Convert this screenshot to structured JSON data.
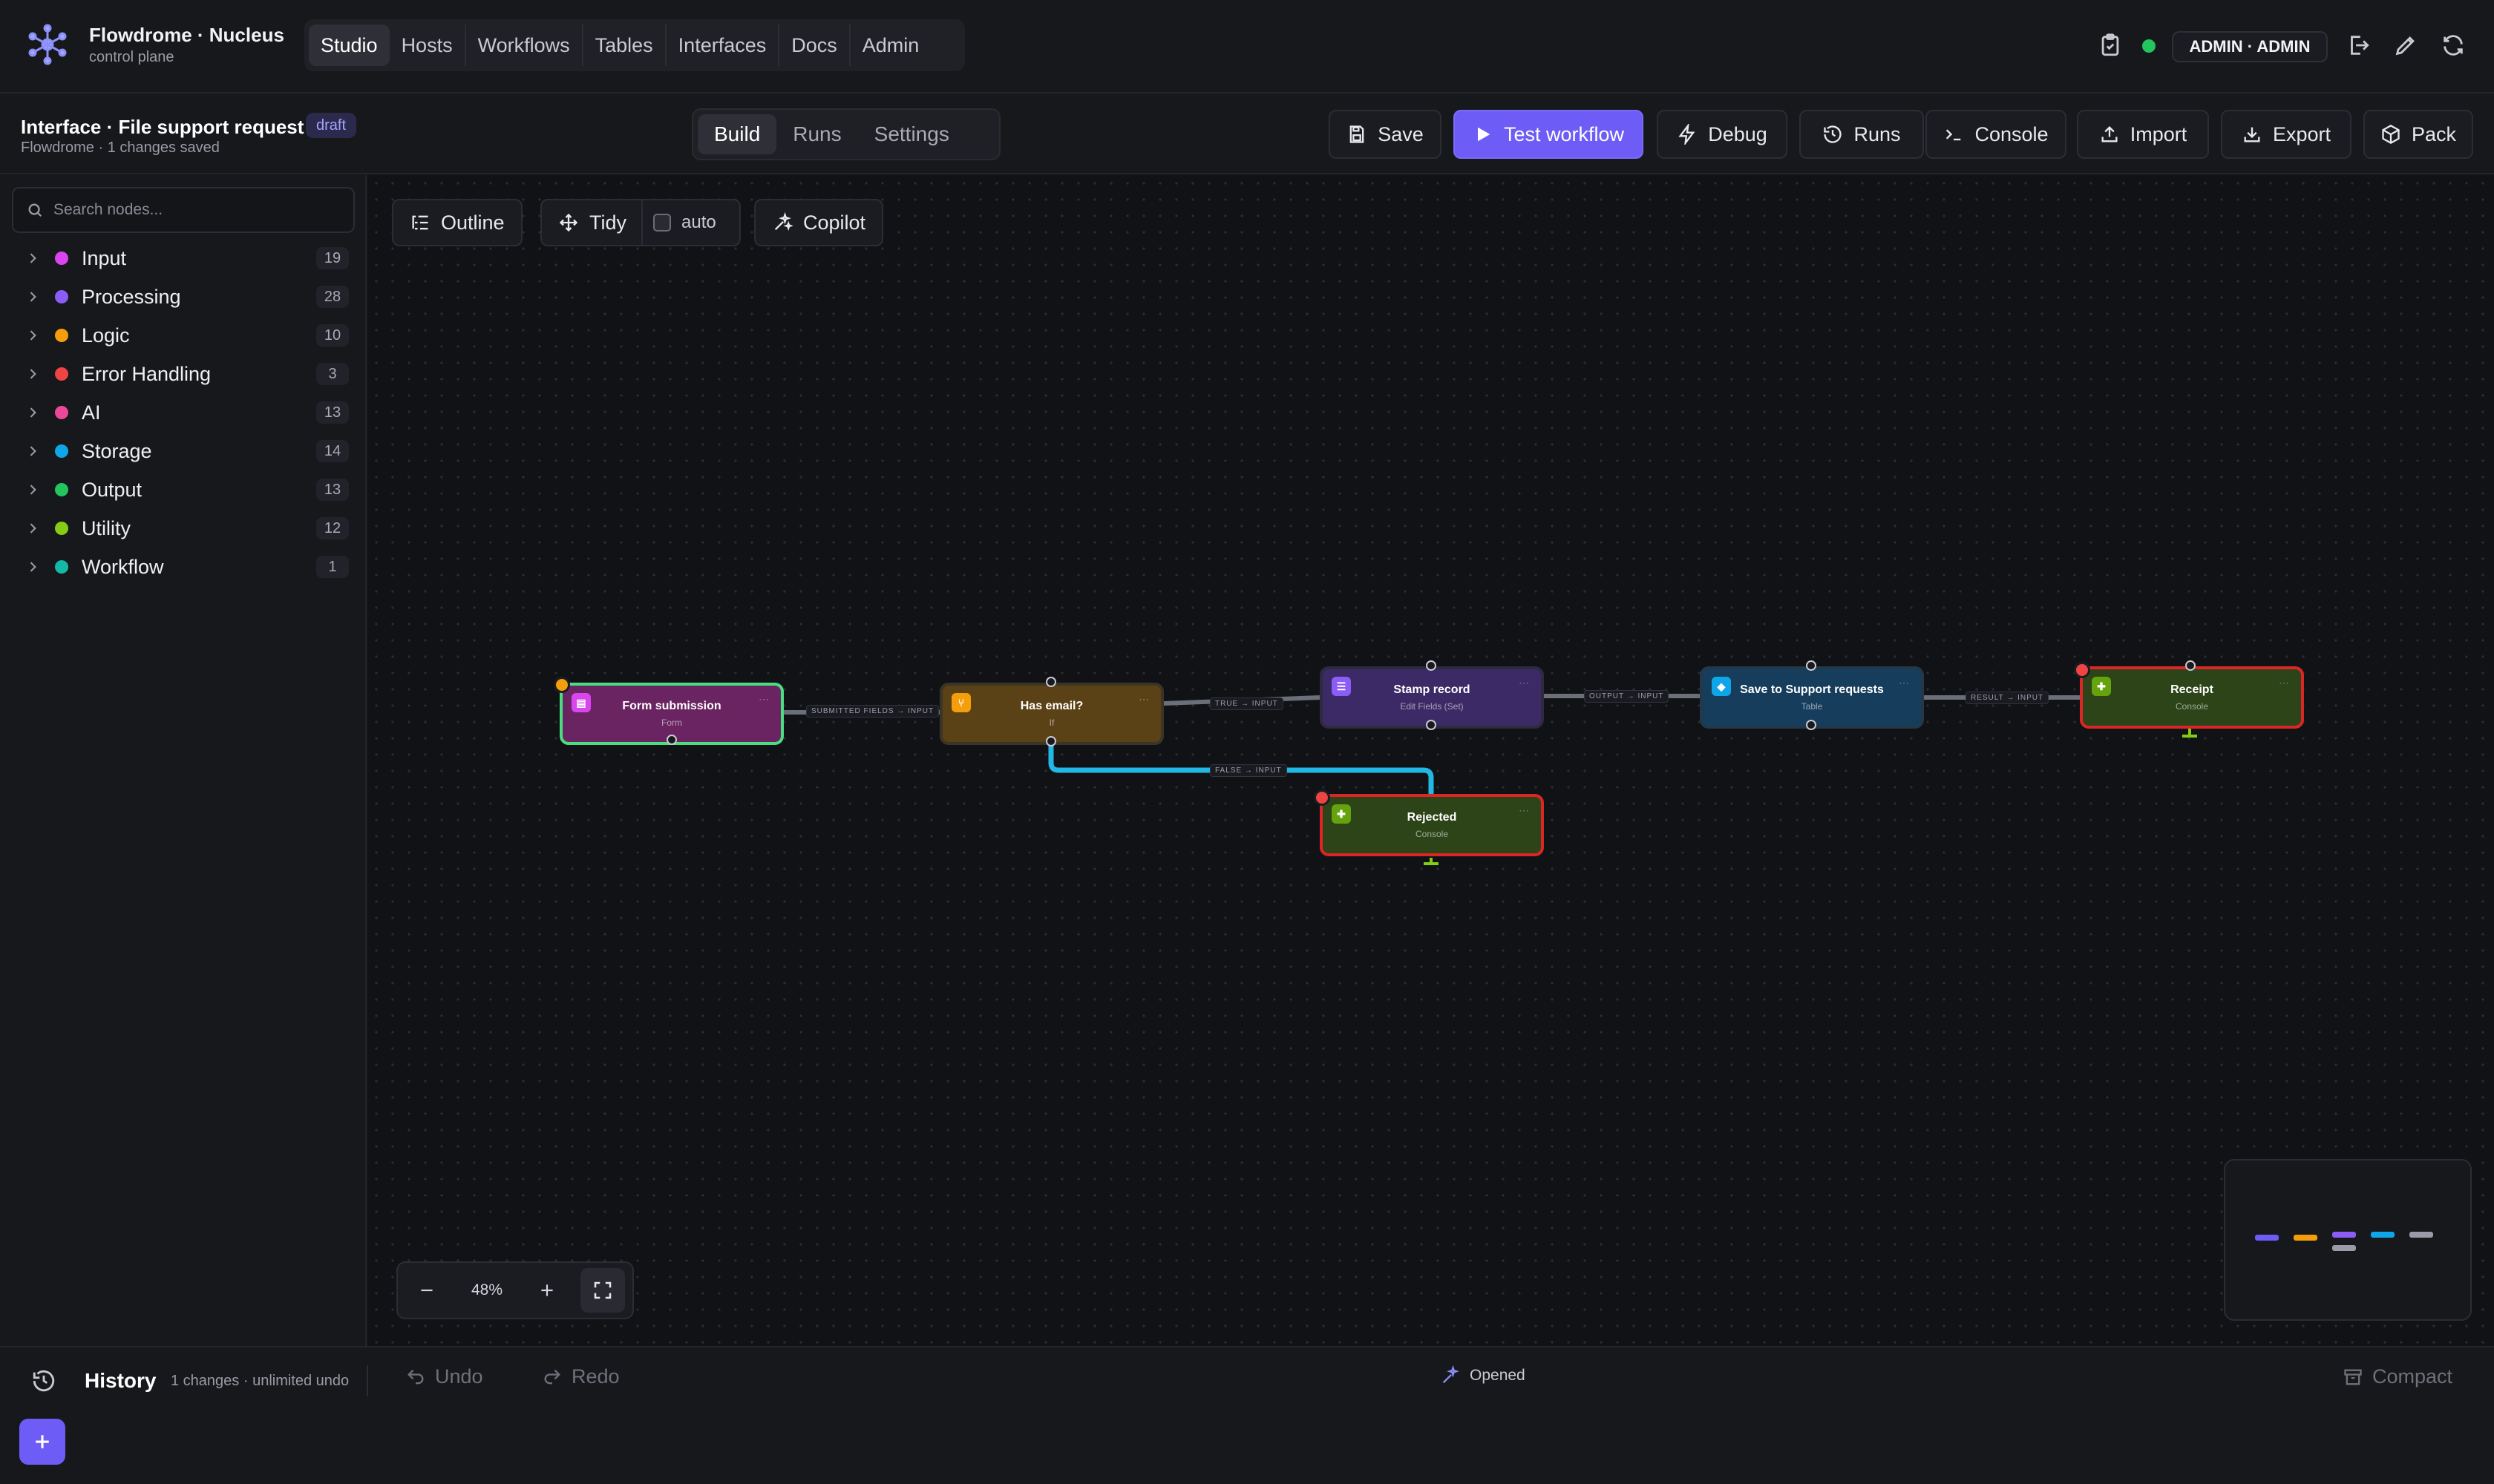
{
  "app": {
    "title": "Flowdrome · Nucleus",
    "subtitle": "control plane"
  },
  "nav": {
    "tabs": [
      "Studio",
      "Hosts",
      "Workflows",
      "Tables",
      "Interfaces",
      "Docs",
      "Admin"
    ],
    "active": "Studio"
  },
  "user": {
    "badge": "ADMIN · ADMIN",
    "status_color": "#22c55e"
  },
  "interface": {
    "title": "Interface · File support request",
    "status": "draft",
    "subtitle": "Flowdrome · 1 changes saved"
  },
  "mode_tabs": {
    "build": "Build",
    "runs": "Runs",
    "settings": "Settings",
    "active": "Build"
  },
  "toolbar": {
    "save": "Save",
    "test": "Test workflow",
    "debug": "Debug",
    "runs": "Runs",
    "console": "Console",
    "import": "Import",
    "export": "Export",
    "pack": "Pack"
  },
  "sidebar": {
    "search_placeholder": "Search nodes...",
    "categories": [
      {
        "label": "Input",
        "count": "19",
        "color": "#d946ef"
      },
      {
        "label": "Processing",
        "count": "28",
        "color": "#8b5cf6"
      },
      {
        "label": "Logic",
        "count": "10",
        "color": "#f59e0b"
      },
      {
        "label": "Error Handling",
        "count": "3",
        "color": "#ef4444"
      },
      {
        "label": "AI",
        "count": "13",
        "color": "#ec4899"
      },
      {
        "label": "Storage",
        "count": "14",
        "color": "#0ea5e9"
      },
      {
        "label": "Output",
        "count": "13",
        "color": "#22c55e"
      },
      {
        "label": "Utility",
        "count": "12",
        "color": "#84cc16"
      },
      {
        "label": "Workflow",
        "count": "1",
        "color": "#14b8a6"
      }
    ]
  },
  "canvas_toolbar": {
    "outline": "Outline",
    "tidy": "Tidy",
    "auto": "auto",
    "copilot": "Copilot"
  },
  "nodes": {
    "form": {
      "title": "Form submission",
      "type": "Form"
    },
    "has_email": {
      "title": "Has email?",
      "type": "If"
    },
    "stamp": {
      "title": "Stamp record",
      "type": "Edit Fields (Set)"
    },
    "save_support": {
      "title": "Save to Support requests",
      "type": "Table"
    },
    "receipt": {
      "title": "Receipt",
      "type": "Console"
    },
    "rejected": {
      "title": "Rejected",
      "type": "Console"
    }
  },
  "edges": {
    "e1": "SUBMITTED FIELDS → INPUT",
    "e2": "TRUE → INPUT",
    "e3": "FALSE → INPUT",
    "e4": "OUTPUT → INPUT",
    "e5": "RESULT → INPUT"
  },
  "zoom": {
    "value": "48%"
  },
  "footer": {
    "history": "History",
    "history_sub": "1 changes · unlimited undo",
    "undo": "Undo",
    "redo": "Redo",
    "status": "Opened",
    "compact": "Compact"
  }
}
